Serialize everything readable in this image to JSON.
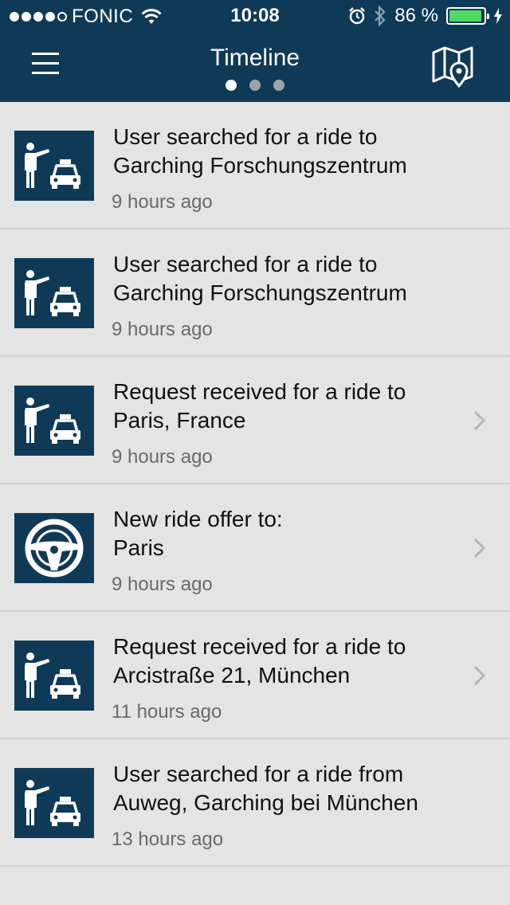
{
  "status_bar": {
    "carrier": "FONIC",
    "time": "10:08",
    "battery_percent": "86 %",
    "battery_level": 0.86,
    "signal_bars": 4
  },
  "header": {
    "title": "Timeline",
    "pages": 3,
    "active_page": 0,
    "menu_icon": "hamburger-menu-icon",
    "map_icon": "map-pin-icon"
  },
  "colors": {
    "header_bg": "#0f3a57",
    "list_bg": "#e4e4e4",
    "battery_fill": "#4cd964"
  },
  "items": [
    {
      "icon": "taxi-hail-icon",
      "title": "User searched for a ride to\nGarching Forschungszentrum",
      "time": "9 hours ago",
      "chevron": false
    },
    {
      "icon": "taxi-hail-icon",
      "title": "User searched for a ride to\nGarching Forschungszentrum",
      "time": "9 hours ago",
      "chevron": false
    },
    {
      "icon": "taxi-hail-icon",
      "title": "Request received for a ride to\nParis, France",
      "time": "9 hours ago",
      "chevron": true
    },
    {
      "icon": "steering-wheel-icon",
      "title": "New ride offer to:\nParis",
      "time": "9 hours ago",
      "chevron": true
    },
    {
      "icon": "taxi-hail-icon",
      "title": "Request received for a ride to\nArcistraße 21, München",
      "time": "11 hours ago",
      "chevron": true
    },
    {
      "icon": "taxi-hail-icon",
      "title": "User searched for a ride from\nAuweg, Garching bei München",
      "time": "13 hours ago",
      "chevron": false
    }
  ]
}
